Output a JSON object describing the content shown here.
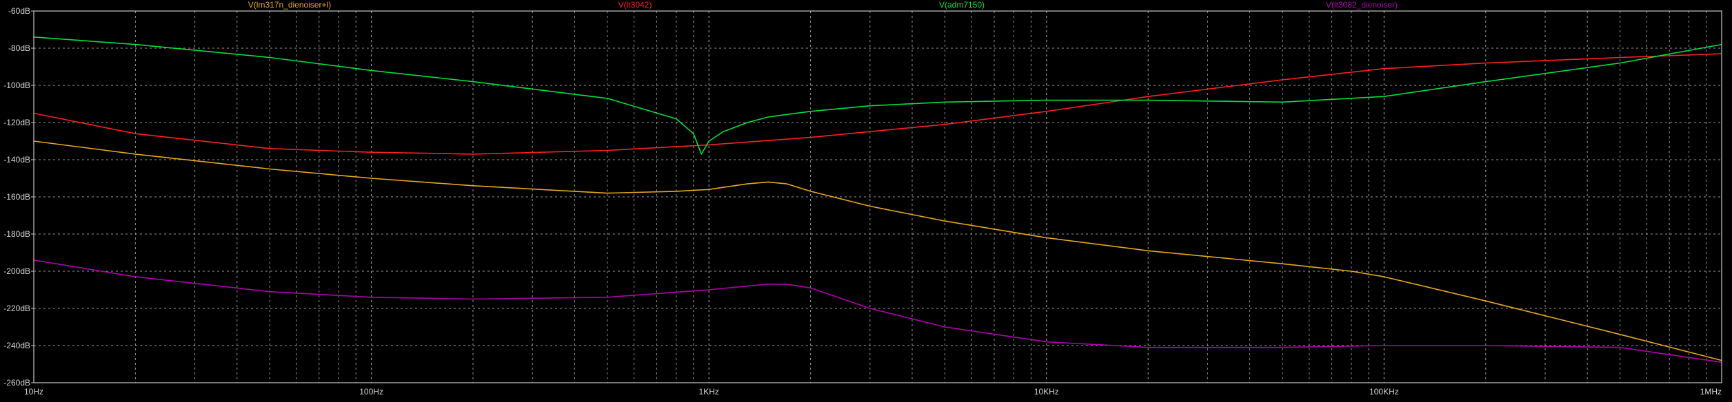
{
  "chart_data": {
    "type": "line",
    "title": "",
    "xlabel": "",
    "ylabel": "",
    "x_scale": "log",
    "xlim": [
      10,
      1000000
    ],
    "ylim": [
      -260,
      -60
    ],
    "grid": true,
    "colors": {
      "background": "#000000",
      "axis": "#c8c8c8",
      "grid": "#9a9a9a",
      "tick_label": "#d8d8d8"
    },
    "x_ticks": [
      {
        "value": 10,
        "label": "10Hz"
      },
      {
        "value": 100,
        "label": "100Hz"
      },
      {
        "value": 1000,
        "label": "1KHz"
      },
      {
        "value": 10000,
        "label": "10KHz"
      },
      {
        "value": 100000,
        "label": "100KHz"
      },
      {
        "value": 1000000,
        "label": "1MHz"
      }
    ],
    "y_ticks": [
      {
        "value": -60,
        "label": "-60dB"
      },
      {
        "value": -80,
        "label": "-80dB"
      },
      {
        "value": -100,
        "label": "-100dB"
      },
      {
        "value": -120,
        "label": "-120dB"
      },
      {
        "value": -140,
        "label": "-140dB"
      },
      {
        "value": -160,
        "label": "-160dB"
      },
      {
        "value": -180,
        "label": "-180dB"
      },
      {
        "value": -200,
        "label": "-200dB"
      },
      {
        "value": -220,
        "label": "-220dB"
      },
      {
        "value": -240,
        "label": "-240dB"
      },
      {
        "value": -260,
        "label": "-260dB"
      }
    ],
    "series": [
      {
        "name": "V(lm317n_dienoiser+l)",
        "color": "#e8a81c",
        "x": [
          10,
          20,
          50,
          100,
          200,
          500,
          800,
          1000,
          1300,
          1500,
          1700,
          2000,
          3000,
          5000,
          10000,
          20000,
          50000,
          80000,
          100000,
          200000,
          500000,
          1000000
        ],
        "y": [
          -130,
          -137,
          -145,
          -150,
          -154,
          -158,
          -157,
          -156,
          -153,
          -152,
          -153,
          -157,
          -165,
          -173,
          -182,
          -189,
          -196,
          -200,
          -203,
          -216,
          -234,
          -248
        ]
      },
      {
        "name": "V(lt3042)",
        "color": "#ff2020",
        "x": [
          10,
          20,
          50,
          100,
          200,
          500,
          1000,
          2000,
          5000,
          10000,
          20000,
          50000,
          100000,
          200000,
          500000,
          1000000
        ],
        "y": [
          -115,
          -126,
          -134,
          -136,
          -137,
          -135,
          -132,
          -128,
          -121,
          -114,
          -106,
          -97,
          -91,
          -88,
          -85,
          -83
        ]
      },
      {
        "name": "V(adm7150)",
        "color": "#00e040",
        "x": [
          10,
          20,
          50,
          100,
          200,
          500,
          800,
          900,
          950,
          1000,
          1100,
          1300,
          1500,
          2000,
          3000,
          5000,
          10000,
          20000,
          50000,
          100000,
          200000,
          500000,
          1000000
        ],
        "y": [
          -74,
          -78,
          -85,
          -92,
          -98,
          -107,
          -118,
          -126,
          -137,
          -130,
          -125,
          -120,
          -117,
          -114,
          -111,
          -109,
          -108,
          -108,
          -109,
          -106,
          -98,
          -88,
          -78
        ]
      },
      {
        "name": "V(lt3082_dienoiser)",
        "color": "#b000b0",
        "x": [
          10,
          20,
          50,
          100,
          200,
          500,
          1000,
          1300,
          1500,
          1700,
          2000,
          3000,
          5000,
          10000,
          20000,
          50000,
          100000,
          200000,
          500000,
          1000000
        ],
        "y": [
          -194,
          -203,
          -211,
          -214,
          -215,
          -214,
          -210,
          -208,
          -207,
          -207,
          -209,
          -220,
          -230,
          -238,
          -241,
          -241,
          -240,
          -240,
          -241,
          -249
        ]
      }
    ]
  }
}
